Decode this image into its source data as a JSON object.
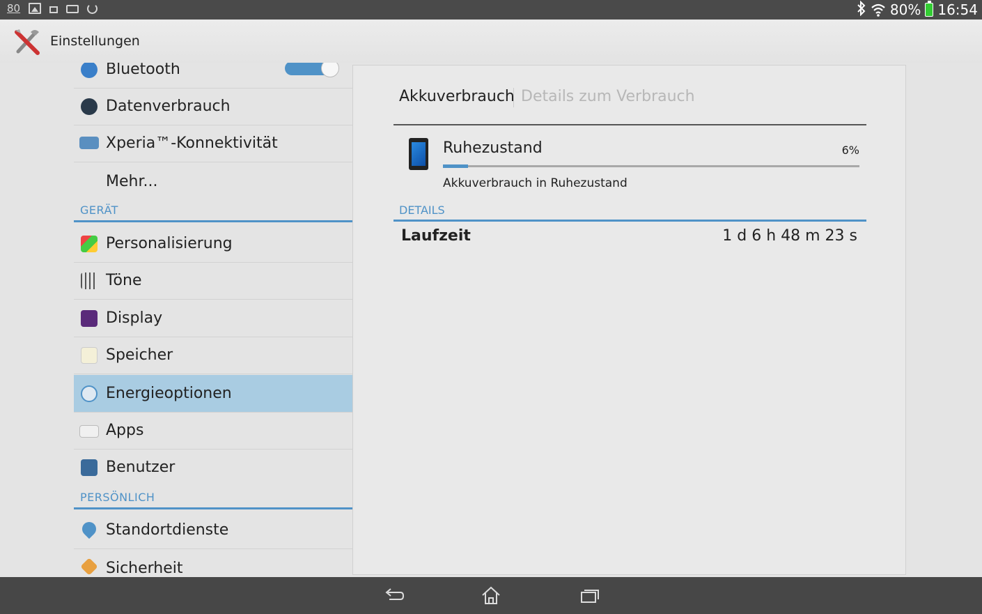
{
  "status_bar": {
    "notification_count": "80",
    "left_icons": [
      "image-icon",
      "lock-rotate-icon",
      "usb-icon",
      "sync-icon"
    ],
    "right_icons": [
      "bluetooth-icon",
      "wifi-icon",
      "battery-icon"
    ],
    "battery_percent": "80%",
    "time": "16:54"
  },
  "action_bar": {
    "icon": "settings-tools-icon",
    "title": "Einstellungen"
  },
  "sidebar": {
    "items": [
      {
        "label": "Bluetooth",
        "icon": "bluetooth-icon",
        "toggle": true
      },
      {
        "label": "Datenverbrauch",
        "icon": "data-usage-icon"
      },
      {
        "label": "Xperia™-Konnektivität",
        "icon": "xperia-connectivity-icon"
      },
      {
        "label": "Mehr...",
        "icon": ""
      }
    ],
    "section_device": "GERÄT",
    "device_items": [
      {
        "label": "Personalisierung",
        "icon": "personalization-icon"
      },
      {
        "label": "Töne",
        "icon": "sound-equalizer-icon"
      },
      {
        "label": "Display",
        "icon": "display-icon"
      },
      {
        "label": "Speicher",
        "icon": "storage-icon"
      },
      {
        "label": "Energieoptionen",
        "icon": "power-options-icon",
        "selected": true
      },
      {
        "label": "Apps",
        "icon": "apps-icon"
      },
      {
        "label": "Benutzer",
        "icon": "users-icon"
      }
    ],
    "section_personal": "PERSÖNLICH",
    "personal_items": [
      {
        "label": "Standortdienste",
        "icon": "location-icon"
      },
      {
        "label": "Sicherheit",
        "icon": "security-icon"
      }
    ]
  },
  "detail": {
    "tab_active": "Akkuverbrauch",
    "tab_inactive": "Details zum Verbrauch",
    "usage": {
      "icon": "phone-icon",
      "title": "Ruhezustand",
      "percent_label": "6%",
      "percent_value": 0.06,
      "subtitle": "Akkuverbrauch in Ruhezustand"
    },
    "details_header": "DETAILS",
    "runtime_label": "Laufzeit",
    "runtime_value": "1 d 6 h 48 m 23 s"
  },
  "nav_bar": {
    "buttons": [
      "back-icon",
      "home-icon",
      "recent-apps-icon"
    ]
  },
  "colors": {
    "accent": "#4f92c7",
    "selected_row": "#a9cce2",
    "status_bar": "#4a4a4a",
    "nav_bar": "#474747"
  }
}
